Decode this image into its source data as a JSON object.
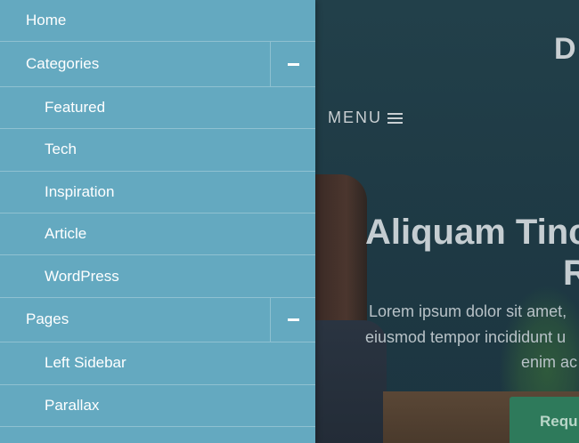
{
  "drawer": {
    "items": [
      {
        "label": "Home",
        "level": 0,
        "expandable": false
      },
      {
        "label": "Categories",
        "level": 0,
        "expandable": true,
        "expanded": true
      },
      {
        "label": "Featured",
        "level": 1,
        "expandable": false
      },
      {
        "label": "Tech",
        "level": 1,
        "expandable": false
      },
      {
        "label": "Inspiration",
        "level": 1,
        "expandable": false
      },
      {
        "label": "Article",
        "level": 1,
        "expandable": false
      },
      {
        "label": "WordPress",
        "level": 1,
        "expandable": false
      },
      {
        "label": "Pages",
        "level": 0,
        "expandable": true,
        "expanded": true
      },
      {
        "label": "Left Sidebar",
        "level": 1,
        "expandable": false
      },
      {
        "label": "Parallax",
        "level": 1,
        "expandable": false
      }
    ],
    "toggle_icon": "minus-icon"
  },
  "header": {
    "brand_visible": "D",
    "menu_label": "MENU",
    "menu_icon": "hamburger-icon"
  },
  "hero": {
    "title_line1": "Aliquam Tinc",
    "title_line2": "R",
    "text_line1": "Lorem ipsum dolor sit amet,",
    "text_line2": "eiusmod tempor incididunt u",
    "text_line3": "enim ac",
    "cta_label": "Requ"
  },
  "colors": {
    "drawer_bg": "#64a9c0",
    "overlay_bg": "#1f3a44",
    "cta_bg": "#2e7a5b"
  }
}
